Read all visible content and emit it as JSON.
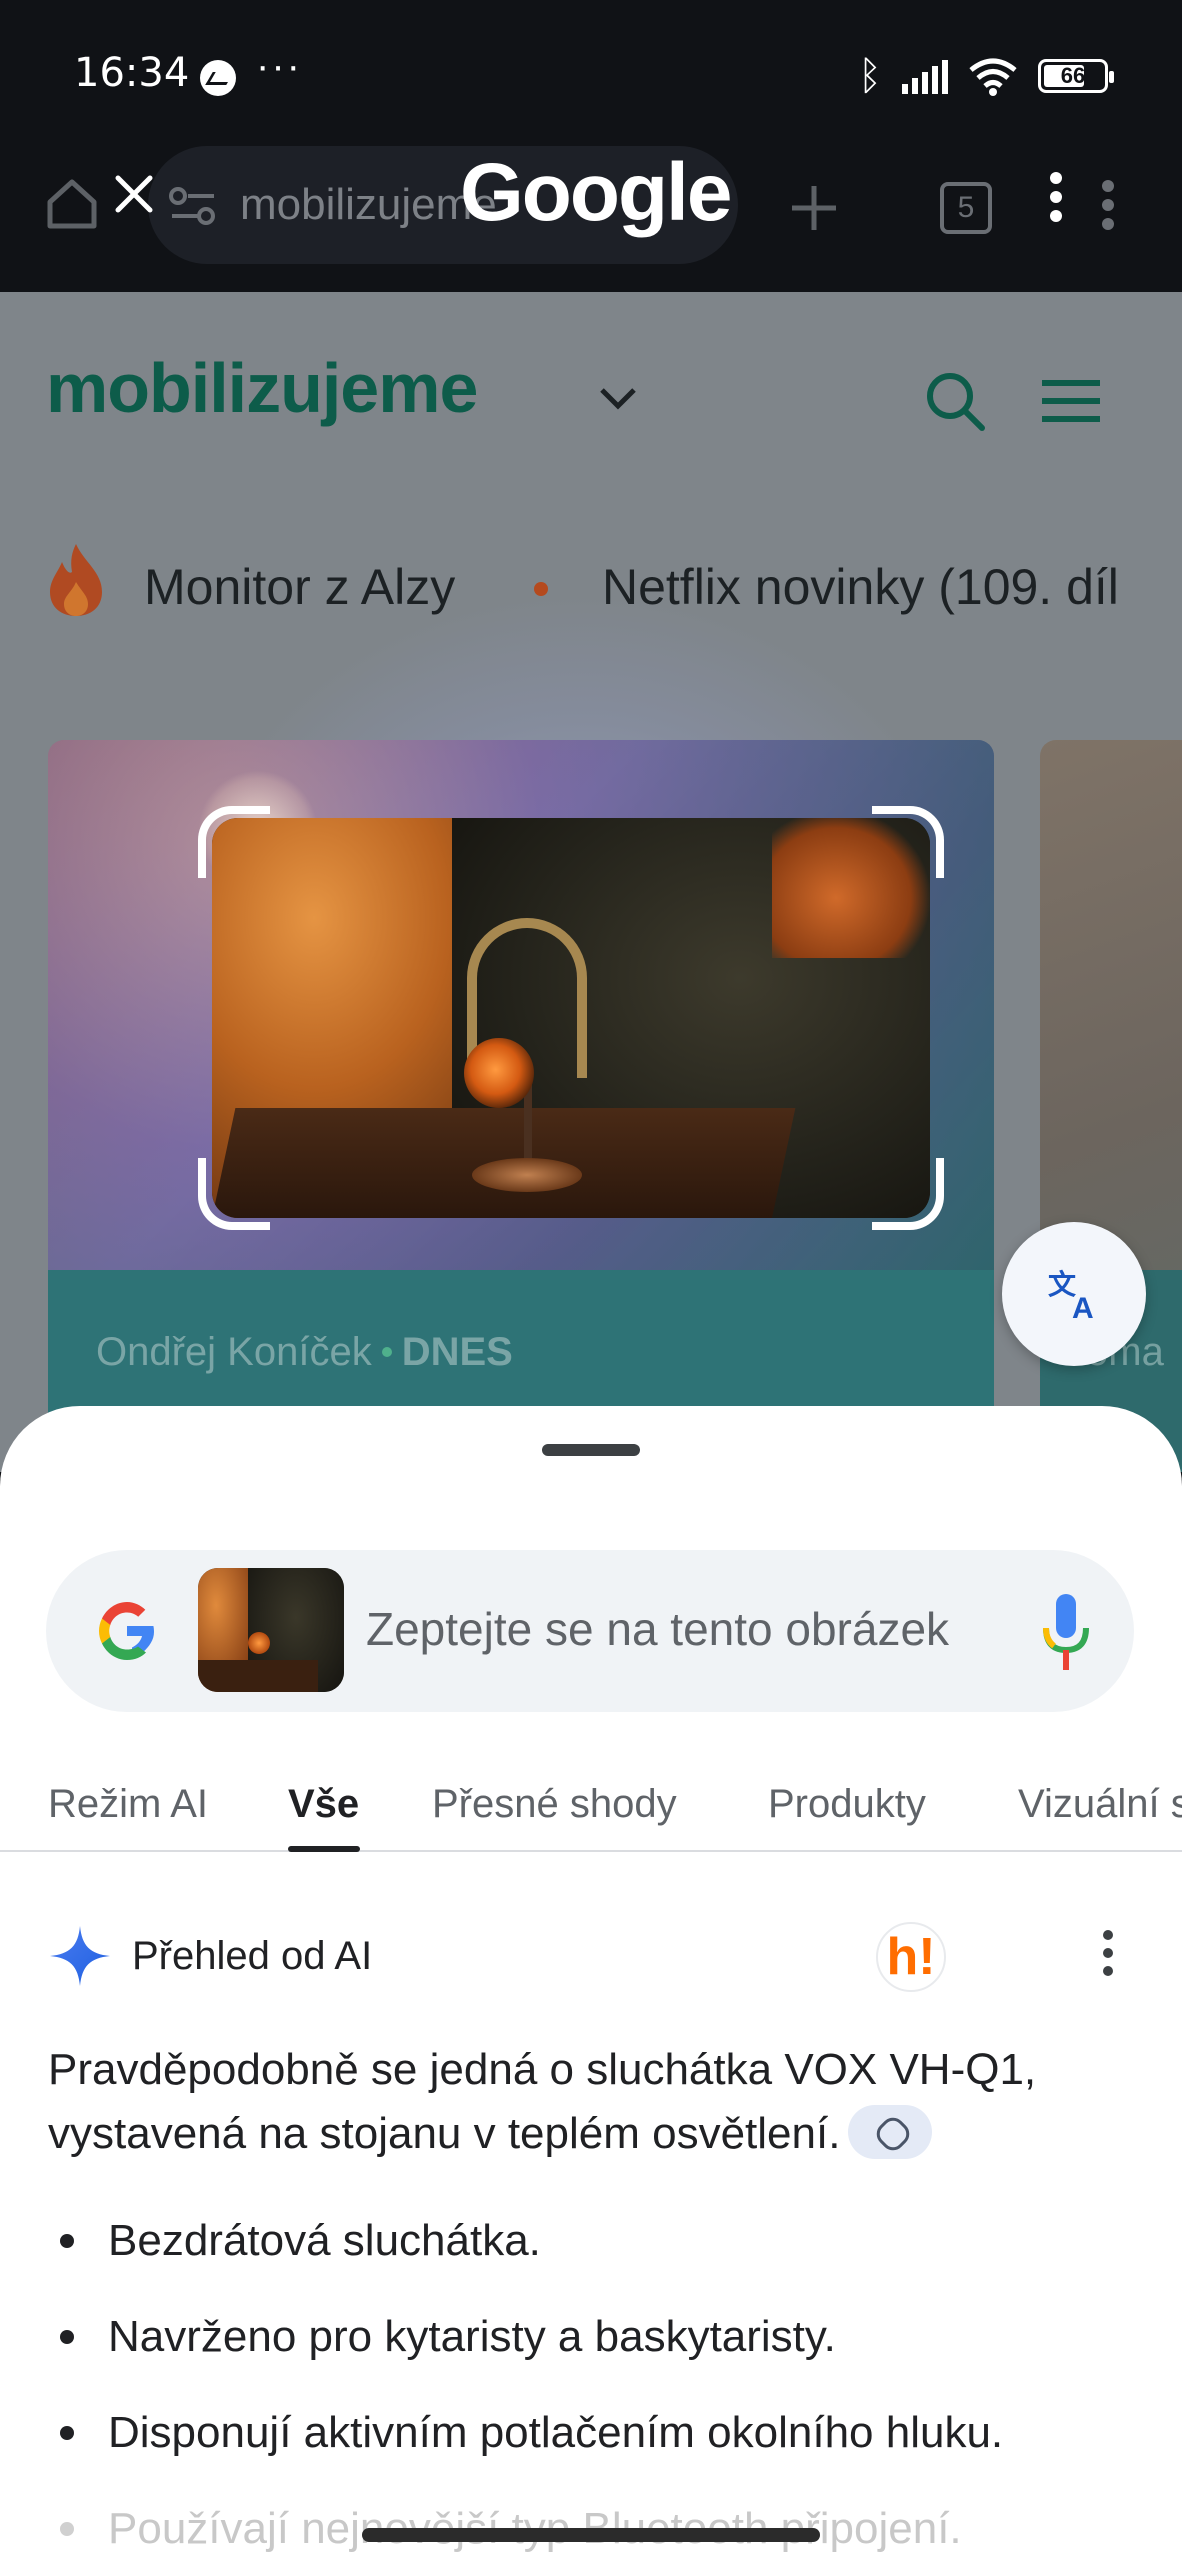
{
  "status_bar": {
    "time": "16:34",
    "more_indicator": "···",
    "battery": "66",
    "icons": [
      "messenger-icon",
      "bluetooth-icon",
      "signal-icon",
      "wifi-icon",
      "battery-icon"
    ]
  },
  "browser": {
    "url": "mobilizujeme",
    "overlay_title": "Google",
    "tab_count": "5"
  },
  "webpage": {
    "logo": "mobilizujeme",
    "ticker": [
      "Monitor z Alzy",
      "Netflix novinky (109. díl"
    ],
    "card": {
      "author": "Ondřej Koníček",
      "date": "DNES"
    },
    "card2_author_fragment": "Toma"
  },
  "lens": {
    "search_placeholder": "Zeptejte se na tento obrázek",
    "tabs": [
      {
        "label": "Režim AI",
        "active": false
      },
      {
        "label": "Vše",
        "active": true
      },
      {
        "label": "Přesné shody",
        "active": false
      },
      {
        "label": "Produkty",
        "active": false
      },
      {
        "label": "Vizuální s",
        "active": false
      }
    ],
    "ai_overview": {
      "title": "Přehled od AI",
      "source_logo": "h!",
      "summary": "Pravděpodobně se jedná o sluchátka VOX VH-Q1, vystavená na stojanu v teplém osvětlení.",
      "bullets": [
        "Bezdrátová sluchátka.",
        "Navrženo pro kytaristy a baskytaristy.",
        "Disponují aktivním potlačením okolního hluku.",
        "Používají nejnovější typ Bluetooth připojení."
      ]
    }
  },
  "colors": {
    "site_brand": "#0d5c4a",
    "google_blue": "#4285F4",
    "google_red": "#EA4335",
    "google_yellow": "#FBBC05",
    "google_green": "#34A853"
  }
}
